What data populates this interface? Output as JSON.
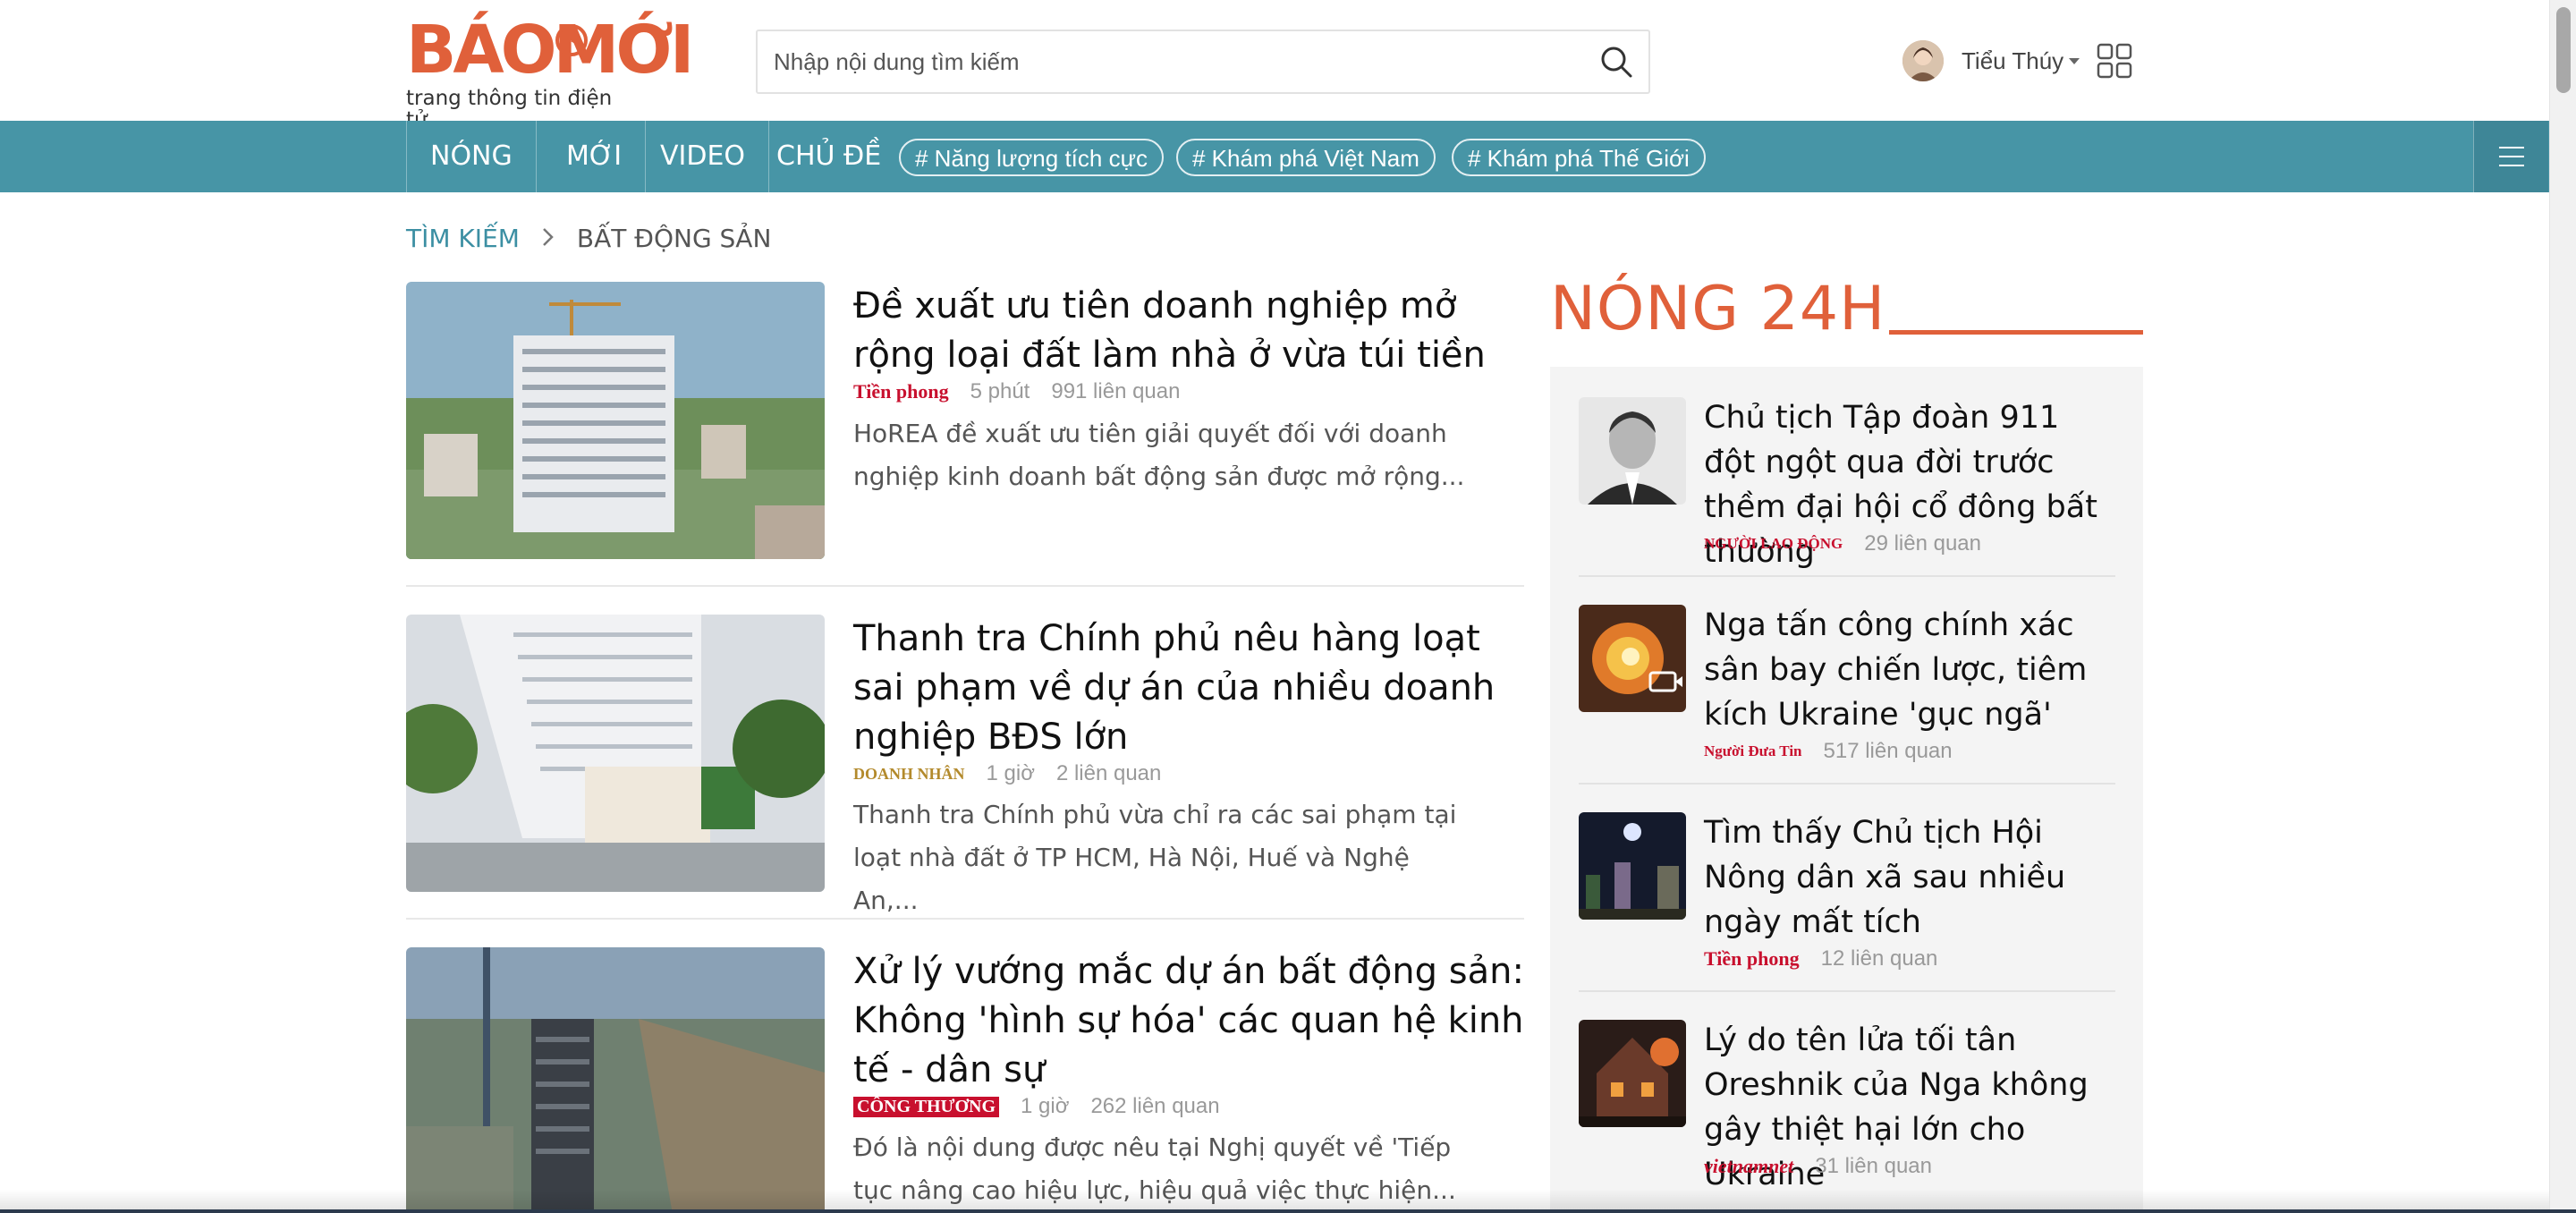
{
  "brand": {
    "logo_text": "BÁOMỚI",
    "tagline": "trang thông tin điện tử",
    "primary_color": "#e0603a",
    "nav_color": "#4795a6"
  },
  "search": {
    "placeholder": "Nhập nội dung tìm kiếm",
    "icon": "search-icon"
  },
  "user": {
    "name": "Tiểu Thúy",
    "apps_icon": "grid-apps-icon"
  },
  "nav": {
    "items": [
      "NÓNG",
      "MỚI",
      "VIDEO",
      "CHỦ ĐỀ"
    ],
    "tags": [
      "# Năng lượng tích cực",
      "# Khám phá Việt Nam",
      "# Khám phá Thế Giới"
    ],
    "menu_icon": "hamburger-menu-icon"
  },
  "breadcrumb": {
    "root": "TÌM KIẾM",
    "separator": ">",
    "current": "BẤT ĐỘNG SẢN"
  },
  "articles": [
    {
      "title": "Đề xuất ưu tiên doanh nghiệp mở rộng loại đất làm nhà ở vừa túi tiền",
      "source": "Tiền phong",
      "time": "5 phút",
      "related": "991 liên quan",
      "summary": "HoREA đề xuất ưu tiên giải quyết đối với doanh nghiệp kinh doanh bất động sản được mở rộng..."
    },
    {
      "title": "Thanh tra Chính phủ nêu hàng loạt sai phạm về dự án của nhiều doanh nghiệp BĐS lớn",
      "source": "DOANH NHÂN",
      "time": "1 giờ",
      "related": "2 liên quan",
      "summary": "Thanh tra Chính phủ vừa chỉ ra các sai phạm tại loạt nhà đất ở TP HCM, Hà Nội, Huế và Nghệ An,..."
    },
    {
      "title": "Xử lý vướng mắc dự án bất động sản: Không 'hình sự hóa' các quan hệ kinh tế - dân sự",
      "source": "CÔNG THƯƠNG",
      "time": "1 giờ",
      "related": "262 liên quan",
      "summary": "Đó là nội dung được nêu tại Nghị quyết về 'Tiếp tục nâng cao hiệu lực, hiệu quả việc thực hiện..."
    }
  ],
  "sidebar": {
    "title": "NÓNG 24H",
    "items": [
      {
        "title": "Chủ tịch Tập đoàn 911 đột ngột qua đời trước thềm đại hội cổ đông bất thường",
        "source": "NGƯỜI LAO ĐỘNG",
        "related": "29 liên quan"
      },
      {
        "title": "Nga tấn công chính xác sân bay chiến lược, tiêm kích Ukraine 'gục ngã'",
        "source": "Người Đưa Tin",
        "related": "517 liên quan"
      },
      {
        "title": "Tìm thấy Chủ tịch Hội Nông dân xã sau nhiều ngày mất tích",
        "source": "Tiền phong",
        "related": "12 liên quan"
      },
      {
        "title": "Lý do tên lửa tối tân Oreshnik của Nga không gây thiệt hại lớn cho Ukraine",
        "source": "vietnamnet",
        "related": "31 liên quan"
      }
    ]
  }
}
